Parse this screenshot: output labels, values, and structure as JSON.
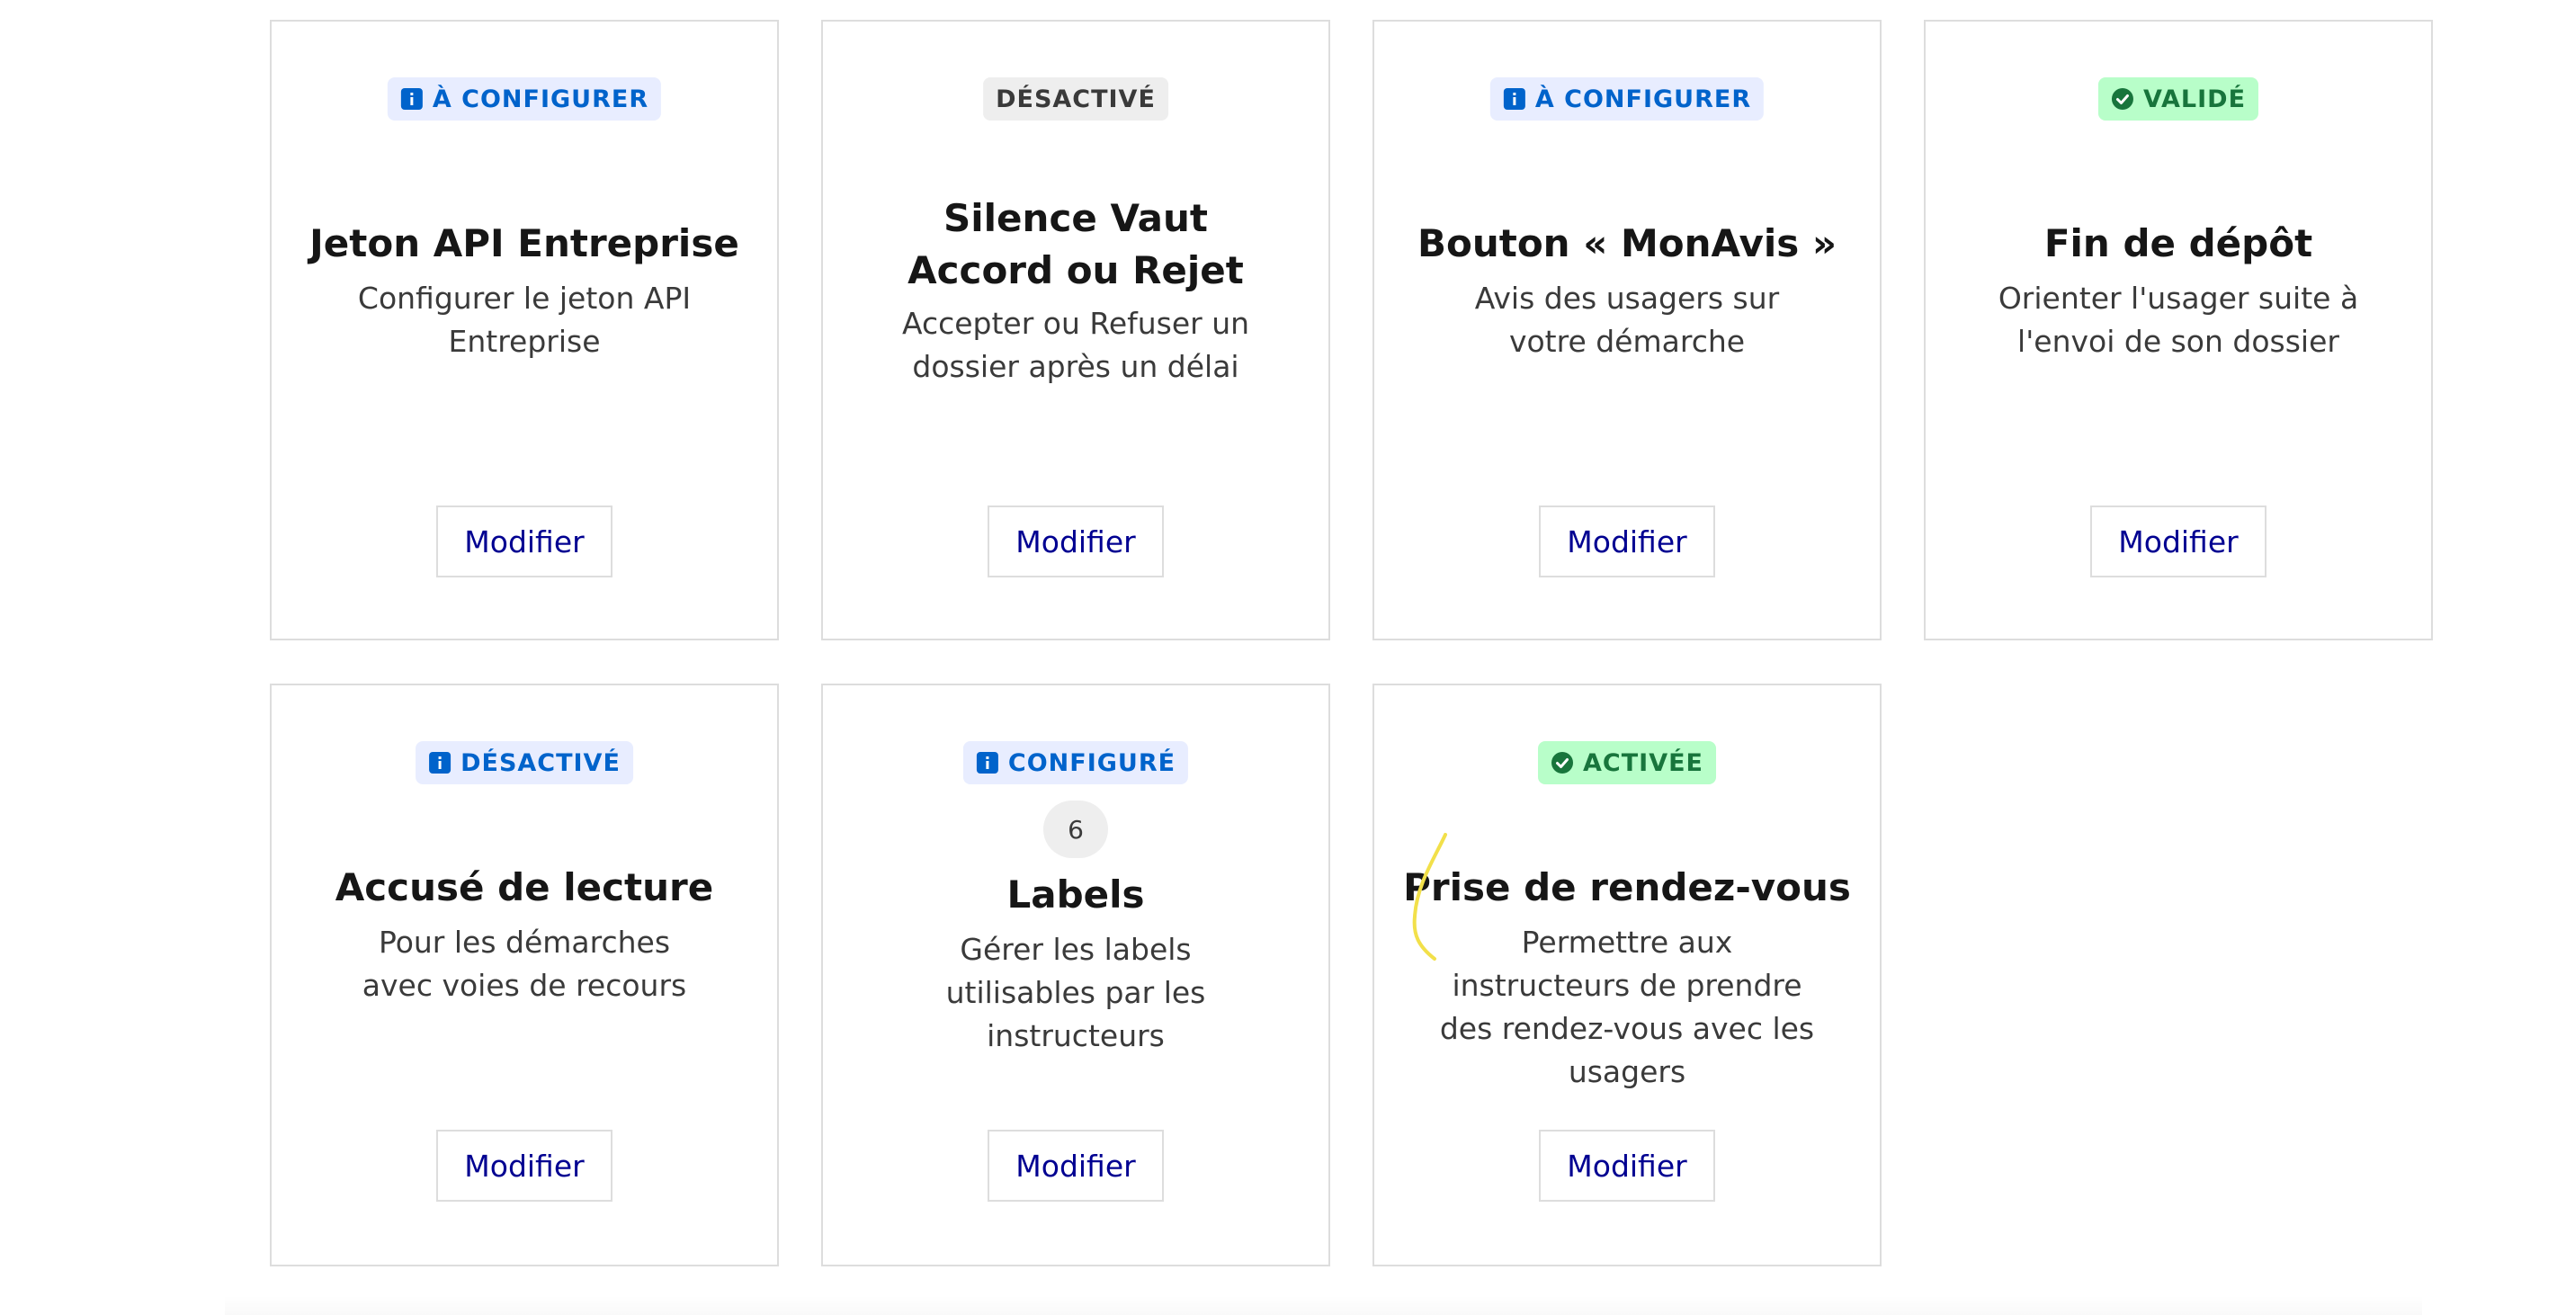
{
  "cards": [
    {
      "badge": {
        "label": "À CONFIGURER",
        "variant": "info",
        "icon": "info-icon"
      },
      "title": "Jeton API Entreprise",
      "description": "Configurer le jeton API Entreprise",
      "button_label": "Modifier"
    },
    {
      "badge": {
        "label": "DÉSACTIVÉ",
        "variant": "neutral",
        "icon": null
      },
      "title": "Silence Vaut Accord ou Rejet",
      "description": "Accepter ou Refuser un dossier après un délai",
      "button_label": "Modifier"
    },
    {
      "badge": {
        "label": "À CONFIGURER",
        "variant": "info",
        "icon": "info-icon"
      },
      "title": "Bouton « MonAvis »",
      "description": "Avis des usagers sur votre démarche",
      "button_label": "Modifier"
    },
    {
      "badge": {
        "label": "VALIDÉ",
        "variant": "success",
        "icon": "check-circle-icon"
      },
      "title": "Fin de dépôt",
      "description": "Orienter l'usager suite à l'envoi de son dossier",
      "button_label": "Modifier"
    },
    {
      "badge": {
        "label": "DÉSACTIVÉ",
        "variant": "info",
        "icon": "info-icon"
      },
      "title": "Accusé de lecture",
      "description": "Pour les démarches avec voies de recours",
      "button_label": "Modifier"
    },
    {
      "badge": {
        "label": "CONFIGURÉ",
        "variant": "info",
        "icon": "info-icon"
      },
      "count": "6",
      "title": "Labels",
      "description": "Gérer les labels utilisables par les instructeurs",
      "button_label": "Modifier"
    },
    {
      "badge": {
        "label": "ACTIVÉE",
        "variant": "success",
        "icon": "check-circle-icon"
      },
      "title": "Prise de rendez-vous",
      "description": "Permettre aux instructeurs de prendre des rendez-vous avec les usagers",
      "button_label": "Modifier"
    }
  ],
  "colors": {
    "info_bg": "#e8edff",
    "info_fg": "#0063cb",
    "neutral_bg": "#eeeeee",
    "neutral_fg": "#3a3a3a",
    "success_bg": "#b8fec9",
    "success_fg": "#18753c",
    "button_text": "#000091",
    "annotation_stroke": "#f2e04a"
  }
}
